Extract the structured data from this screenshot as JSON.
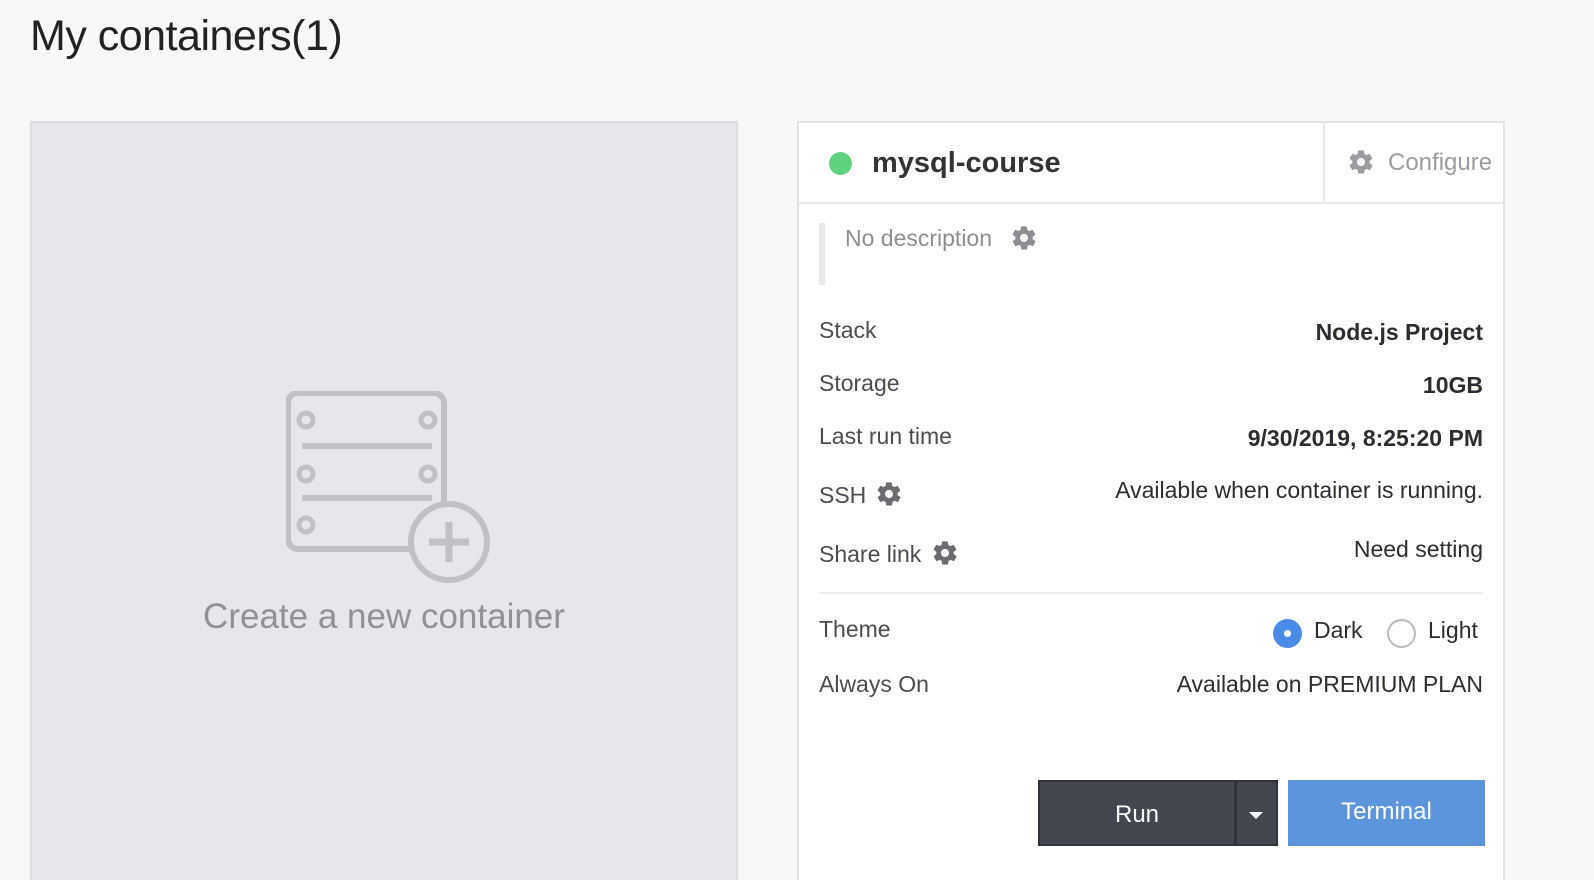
{
  "page": {
    "title": "My containers(1)"
  },
  "create_card": {
    "label": "Create a new container",
    "icon": "server-add-icon"
  },
  "container": {
    "status_color": "#5fd27e",
    "name": "mysql-course",
    "configure_label": "Configure",
    "description": "No description",
    "rows": {
      "stack": {
        "label": "Stack",
        "value": "Node.js Project"
      },
      "storage": {
        "label": "Storage",
        "value": "10GB"
      },
      "last_run": {
        "label": "Last run time",
        "value": "9/30/2019, 8:25:20 PM"
      },
      "ssh": {
        "label": "SSH",
        "value": "Available when container is running."
      },
      "share_link": {
        "label": "Share link",
        "value": "Need setting"
      },
      "theme": {
        "label": "Theme",
        "options": [
          "Dark",
          "Light"
        ],
        "selected": "Dark"
      },
      "always_on": {
        "label": "Always On",
        "value": "Available on PREMIUM PLAN"
      }
    },
    "buttons": {
      "run": "Run",
      "terminal": "Terminal"
    }
  },
  "colors": {
    "accent": "#4a8be8",
    "terminal": "#5b95db",
    "run": "#43474f"
  }
}
